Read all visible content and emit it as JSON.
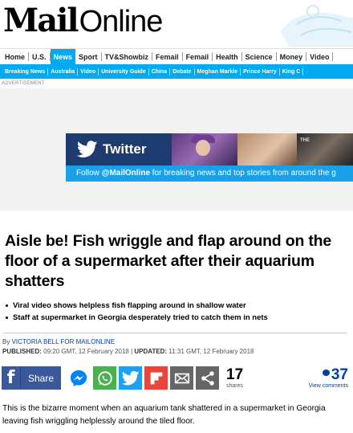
{
  "masthead": {
    "logo_mail": "Mail",
    "logo_online": "Online"
  },
  "nav_primary": [
    {
      "label": "Home",
      "active": false
    },
    {
      "label": "U.S.",
      "active": false
    },
    {
      "label": "News",
      "active": true
    },
    {
      "label": "Sport",
      "active": false
    },
    {
      "label": "TV&Showbiz",
      "active": false
    },
    {
      "label": "Femail",
      "active": false
    },
    {
      "label": "Femail",
      "active": false
    },
    {
      "label": "Health",
      "active": false
    },
    {
      "label": "Science",
      "active": false
    },
    {
      "label": "Money",
      "active": false
    },
    {
      "label": "Video",
      "active": false
    }
  ],
  "nav_secondary": [
    "Breaking News",
    "Australia",
    "Video",
    "University Guide",
    "China",
    "Debate",
    "Meghan Markle",
    "Prince Harry",
    "King C"
  ],
  "advert": {
    "label": "ADVERTISEMENT",
    "twitter_word": "Twitter",
    "follow_prefix": "Follow ",
    "follow_handle": "@MailOnline",
    "follow_suffix": " for breaking news and top stories from around the g",
    "photo3_caption": "THE"
  },
  "article": {
    "headline": "Aisle be! Fish wriggle and flap around on the floor of a supermarket after their aquarium shatters",
    "bullets": [
      "Viral video shows helpless fish flapping around in shallow water",
      "Staff at supermarket in Georgia desperately tried to catch them in nets"
    ],
    "byline_by": "By ",
    "byline_author": "VICTORIA BELL FOR MAILONLINE",
    "published_label": "PUBLISHED:",
    "published_value": " 09:20 GMT, 12 February 2018 | ",
    "updated_label": "UPDATED:",
    "updated_value": " 11:31 GMT, 12 February 2018",
    "body": "This is the bizarre moment when an aquarium tank shattered in a supermarket in Georgia leaving fish wriggling helplessly around the tiled floor."
  },
  "share": {
    "facebook_label": "Share",
    "share_count": "17",
    "share_count_label": "shares",
    "comment_count": "37",
    "comment_label": "View comments"
  },
  "colors": {
    "nav_blue": "#00aaf0",
    "facebook": "#3b5998",
    "twitter": "#1da1f2",
    "whatsapp": "#4caf50",
    "flipboard": "#e8453c",
    "link_blue": "#0040a0"
  },
  "icons": [
    "facebook-icon",
    "messenger-icon",
    "whatsapp-icon",
    "twitter-icon",
    "flipboard-icon",
    "email-icon",
    "share-more-icon",
    "comment-bubble-icon"
  ]
}
